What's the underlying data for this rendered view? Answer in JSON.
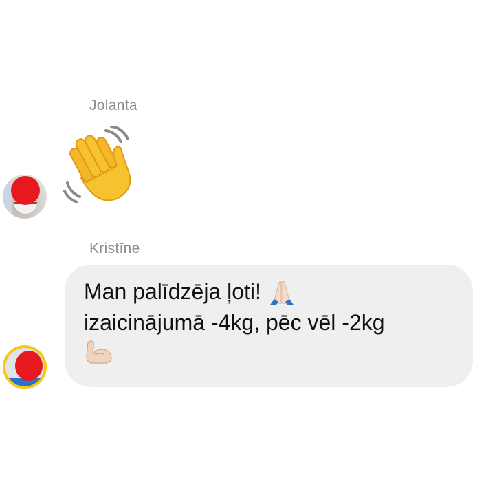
{
  "messages": [
    {
      "sender": "Jolanta",
      "content_type": "emoji",
      "emoji": "waving-hand"
    },
    {
      "sender": "Kristīne",
      "content_type": "text",
      "lines": [
        "Man palīdzēja ļoti!",
        "izaicinājumā -4kg, pēc vēl -2kg",
        ""
      ],
      "emojis": [
        "folded-hands",
        "flexed-biceps"
      ],
      "bubble_color": "#efefef"
    }
  ],
  "colors": {
    "sender_name": "#8e8e8e",
    "text": "#111111",
    "redaction": "#e8191e",
    "avatar_ring": "#f5c915"
  }
}
